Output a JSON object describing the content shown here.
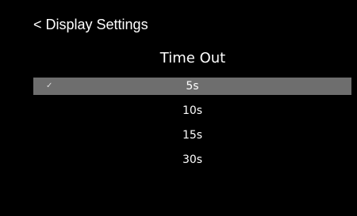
{
  "header": {
    "back_label": "< Display Settings"
  },
  "title": "Time Out",
  "options": [
    {
      "label": "5s",
      "selected": true,
      "check": "✓"
    },
    {
      "label": "10s",
      "selected": false
    },
    {
      "label": "15s",
      "selected": false
    },
    {
      "label": "30s",
      "selected": false
    }
  ],
  "colors": {
    "background": "#000000",
    "text": "#ffffff",
    "selection": "#6e6e6e"
  },
  "icons": {
    "selected_marker": "check-icon"
  }
}
